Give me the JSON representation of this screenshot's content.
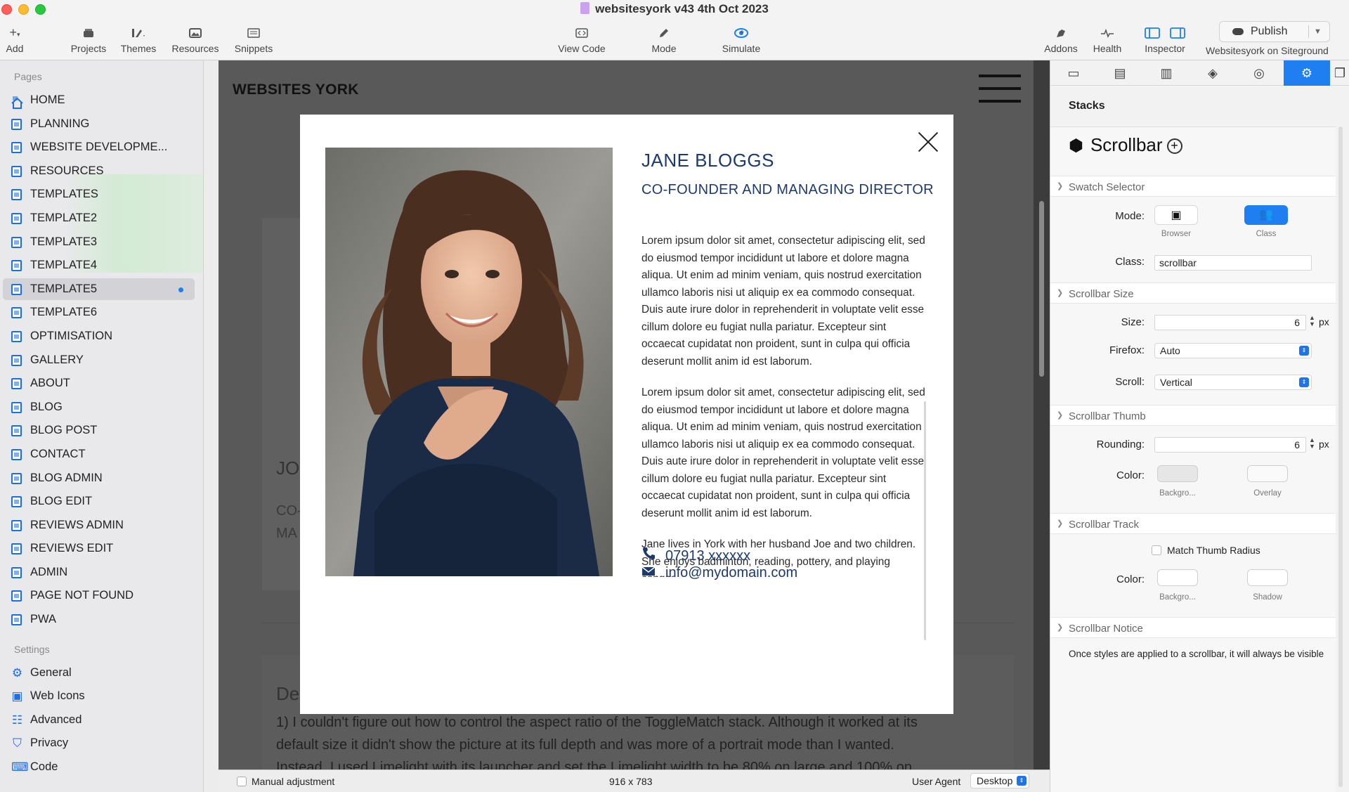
{
  "window": {
    "title": "websitesyork v43 4th Oct 2023"
  },
  "toolbar": {
    "left": [
      {
        "label": "Add",
        "icon": "plus-icon"
      },
      {
        "label": "Projects",
        "icon": "projects-icon"
      },
      {
        "label": "Themes",
        "icon": "themes-icon"
      },
      {
        "label": "Resources",
        "icon": "resources-icon"
      },
      {
        "label": "Snippets",
        "icon": "snippets-icon"
      }
    ],
    "center": [
      {
        "label": "View Code",
        "icon": "code-icon"
      },
      {
        "label": "Mode",
        "icon": "pencil-icon"
      },
      {
        "label": "Simulate",
        "icon": "eye-icon"
      }
    ],
    "right": [
      {
        "label": "Addons",
        "icon": "addons-icon"
      },
      {
        "label": "Health",
        "icon": "pulse-icon"
      },
      {
        "label": "Inspector",
        "icon": "inspector-icon"
      }
    ],
    "publish_label": "Publish",
    "site_label": "Websitesyork on Siteground"
  },
  "sidebar": {
    "pages_header": "Pages",
    "pages": [
      "HOME",
      "PLANNING",
      "WEBSITE  DEVELOPME...",
      "RESOURCES",
      "TEMPLATES",
      "TEMPLATE2",
      "TEMPLATE3",
      "TEMPLATE4",
      "TEMPLATE5",
      "TEMPLATE6",
      "OPTIMISATION",
      "GALLERY",
      "ABOUT",
      "BLOG",
      "BLOG POST",
      "CONTACT",
      "BLOG ADMIN",
      "BLOG EDIT",
      "REVIEWS ADMIN",
      "REVIEWS EDIT",
      "ADMIN",
      "PAGE NOT FOUND",
      "PWA"
    ],
    "active_page": "TEMPLATE5",
    "settings_header": "Settings",
    "settings": [
      {
        "label": "General",
        "icon": "gear-icon"
      },
      {
        "label": "Web Icons",
        "icon": "image-icon"
      },
      {
        "label": "Advanced",
        "icon": "sliders-icon"
      },
      {
        "label": "Privacy",
        "icon": "shield-icon"
      },
      {
        "label": "Code",
        "icon": "code-icon"
      }
    ]
  },
  "canvas": {
    "brand": "WEBSITES YORK",
    "bg_heading_fragment": "JO",
    "bg_sub1": "CO-",
    "bg_sub2": "MA",
    "bg_section_fragment": "De",
    "bg_para": [
      "1) I couldn't figure out how to control the aspect ratio of the ToggleMatch stack. Although it worked at its",
      "default size it didn't show the picture at its full depth and was more of a portrait mode than I wanted.",
      "Instead, I used Limelight with its launcher and set the Limelight width to be 80% on large and 100% on"
    ]
  },
  "modal": {
    "name": "JANE BLOGGS",
    "role": "CO-FOUNDER AND MANAGING DIRECTOR",
    "paragraphs": [
      "Lorem ipsum dolor sit amet, consectetur adipiscing elit, sed do eiusmod tempor incididunt ut labore et dolore magna aliqua. Ut enim ad minim veniam, quis nostrud exercitation ullamco laboris nisi ut aliquip ex ea commodo consequat. Duis aute irure dolor in reprehenderit in voluptate velit esse cillum dolore eu fugiat nulla pariatur. Excepteur sint occaecat cupidatat non proident, sunt in culpa qui officia deserunt mollit anim id est laborum.",
      "Lorem ipsum dolor sit amet, consectetur adipiscing elit, sed do eiusmod tempor incididunt ut labore et dolore magna aliqua. Ut enim ad minim veniam, quis nostrud exercitation ullamco laboris nisi ut aliquip ex ea commodo consequat. Duis aute irure dolor in reprehenderit in voluptate velit esse cillum dolore eu fugiat nulla pariatur. Excepteur sint occaecat cupidatat non proident, sunt in culpa qui officia deserunt mollit anim id est laborum.",
      "Jane lives in York with her husband Joe and two children. She enjoys badminton, reading, pottery, and playing congas."
    ],
    "phone": "07913 xxxxxx",
    "email": "info@mydomain.com"
  },
  "status": {
    "manual_adjustment": "Manual adjustment",
    "dimensions": "916 x 783",
    "user_agent_label": "User Agent",
    "user_agent_value": "Desktop"
  },
  "inspector": {
    "section": "Stacks",
    "stack_name": "Scrollbar",
    "swatch_selector": {
      "header": "Swatch Selector",
      "mode_label": "Mode:",
      "mode_browser": "Browser",
      "mode_class": "Class",
      "class_label": "Class:",
      "class_value": "scrollbar"
    },
    "size_group": {
      "header": "Scrollbar Size",
      "size_label": "Size:",
      "size_value": "6",
      "unit": "px",
      "firefox_label": "Firefox:",
      "firefox_value": "Auto",
      "scroll_label": "Scroll:",
      "scroll_value": "Vertical"
    },
    "thumb_group": {
      "header": "Scrollbar Thumb",
      "rounding_label": "Rounding:",
      "rounding_value": "6",
      "unit": "px",
      "color_label": "Color:",
      "bg_caption": "Backgro...",
      "overlay_caption": "Overlay"
    },
    "track_group": {
      "header": "Scrollbar Track",
      "match_label": "Match Thumb Radius",
      "color_label": "Color:",
      "bg_caption": "Backgro...",
      "shadow_caption": "Shadow"
    },
    "notice_group": {
      "header": "Scrollbar Notice",
      "text": "Once styles are applied to a scrollbar, it will always be visible"
    }
  },
  "colors": {
    "accent": "#1f7ff0",
    "modal_text": "#1d3a6e"
  }
}
